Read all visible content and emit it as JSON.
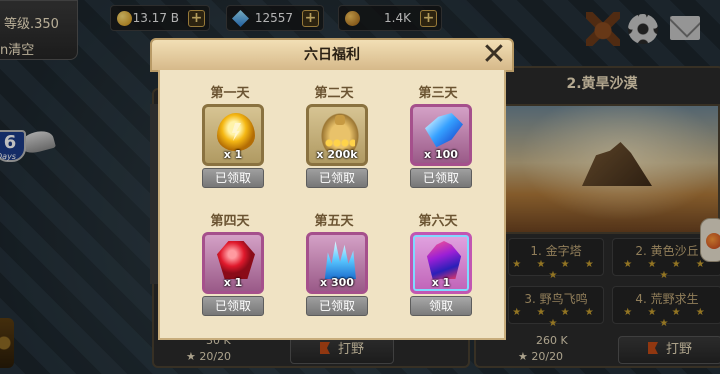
{
  "player": {
    "level_text": "等级.350",
    "name_text": "n清空"
  },
  "resources": [
    {
      "icon": "gold-coin-icon",
      "value": "13.17 B"
    },
    {
      "icon": "blue-gem-icon",
      "value": "12557"
    },
    {
      "icon": "bronze-coin-icon",
      "value": "1.4K"
    }
  ],
  "days_badge": {
    "number": "6",
    "label": "Days"
  },
  "background": {
    "stage_title": "2.黄旱沙漠",
    "sub_stages": [
      {
        "name": "1. 金字塔"
      },
      {
        "name": "2. 黄色沙丘"
      },
      {
        "name": "3. 野鸟飞鸣"
      },
      {
        "name": "4. 荒野求生"
      }
    ],
    "stars_text": "★ ★ ★ ★ ★",
    "left_stats": {
      "power": "30 K",
      "stars": "20/20"
    },
    "right_stats": {
      "power": "260 K",
      "stars": "20/20"
    },
    "hunt_label": "打野"
  },
  "modal": {
    "title": "六日福利",
    "close_symbol": "✕",
    "days": [
      {
        "day": "第一天",
        "item": "golden-egg-icon",
        "qty": "x 1",
        "claim": "已领取"
      },
      {
        "day": "第二天",
        "item": "gold-bag-icon",
        "qty": "x 200k",
        "claim": "已领取"
      },
      {
        "day": "第三天",
        "item": "blue-gem-icon",
        "qty": "x 100",
        "claim": "已领取"
      },
      {
        "day": "第四天",
        "item": "ruby-icon",
        "qty": "x 1",
        "claim": "已领取"
      },
      {
        "day": "第五天",
        "item": "crystal-icon",
        "qty": "x 300",
        "claim": "已领取"
      },
      {
        "day": "第六天",
        "item": "prism-stone-icon",
        "qty": "x 1",
        "claim": "领取"
      }
    ]
  }
}
